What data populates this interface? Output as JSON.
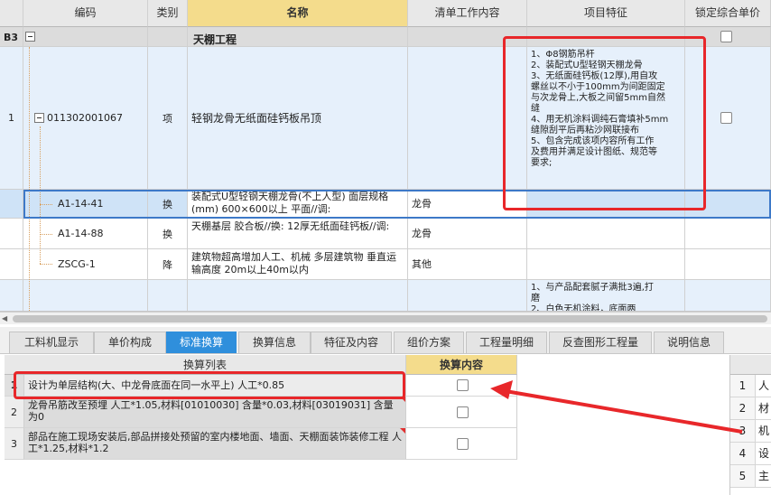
{
  "columns": {
    "code": "编码",
    "type": "类别",
    "name": "名称",
    "work": "清单工作内容",
    "feature": "项目特征",
    "lock": "锁定综合单价"
  },
  "section": {
    "idx": "B3",
    "name": "天棚工程"
  },
  "main_item": {
    "idx": "1",
    "code": "011302001067",
    "type": "项",
    "name": "轻钢龙骨无纸面硅钙板吊顶",
    "feature_lines": [
      "1、Φ8钢筋吊杆",
      "2、装配式U型轻钢天棚龙骨",
      "3、无纸面硅钙板(12厚),用自攻",
      "螺丝以不小于100mm为间距固定",
      "与次龙骨上,大板之间留5mm自然",
      "缝",
      "4、用无机涂料调纯石膏填补5mm",
      "缝隙刮平后再粘沙网联接布",
      "5、包含完成该项内容所有工作",
      "及费用并满足设计图纸、规范等",
      "要求;"
    ]
  },
  "sub_items": [
    {
      "code": "A1-14-41",
      "type": "换",
      "name": "装配式U型轻钢天棚龙骨(不上人型) 面层规格(mm) 600×600以上 平面//调:",
      "work": "龙骨"
    },
    {
      "code": "A1-14-88",
      "type": "换",
      "name": "天棚基层 胶合板//换: 12厚无纸面硅钙板//调:",
      "work": "龙骨"
    },
    {
      "code": "ZSCG-1",
      "type": "降",
      "name": "建筑物超高增加人工、机械 多层建筑物 垂直运输高度 20m以上40m以内",
      "work": "其他"
    }
  ],
  "last_item": {
    "feature_lines": [
      "1、与产品配套腻子满批3遍,打",
      "磨",
      "2、白色无机涂料，底面两"
    ]
  },
  "tabs": [
    {
      "label": "工料机显示",
      "active": false
    },
    {
      "label": "单价构成",
      "active": false
    },
    {
      "label": "标准换算",
      "active": true
    },
    {
      "label": "换算信息",
      "active": false
    },
    {
      "label": "特征及内容",
      "active": false
    },
    {
      "label": "组价方案",
      "active": false
    },
    {
      "label": "工程量明细",
      "active": false
    },
    {
      "label": "反查图形工程量",
      "active": false
    },
    {
      "label": "说明信息",
      "active": false
    }
  ],
  "conversion": {
    "col_list": "换算列表",
    "col_content": "换算内容",
    "rows": [
      {
        "num": "1",
        "desc": "设计为单层结构(大、中龙骨底面在同一水平上) 人工*0.85"
      },
      {
        "num": "2",
        "desc": "龙骨吊筋改至预埋 人工*1.05,材料[01010030] 含量*0.03,材料[03019031] 含量为0"
      },
      {
        "num": "3",
        "desc": "部品在施工现场安装后,部品拼接处预留的室内楼地面、墙面、天棚面装饰装修工程 人工*1.25,材料*1.2"
      }
    ]
  },
  "right_panel": {
    "rows": [
      {
        "num": "1",
        "text": "人"
      },
      {
        "num": "2",
        "text": "材"
      },
      {
        "num": "3",
        "text": "机"
      },
      {
        "num": "4",
        "text": "设"
      },
      {
        "num": "5",
        "text": "主"
      }
    ]
  },
  "colors": {
    "annotation_red": "#e8272a",
    "active_tab": "#2f8fdc",
    "selected_row": "#cfe3f7",
    "header_highlight": "#f4dc8c"
  }
}
